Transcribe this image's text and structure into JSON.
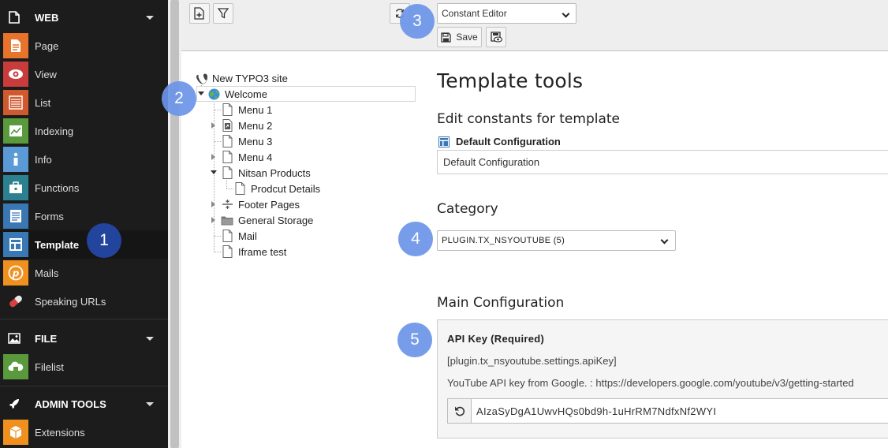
{
  "module_menu": {
    "groups": [
      {
        "title": "WEB",
        "icon": "web-icon",
        "items": [
          {
            "label": "Page",
            "icon": "page-icon",
            "color": "#e8732c"
          },
          {
            "label": "View",
            "icon": "view-icon",
            "color": "#c83c3c"
          },
          {
            "label": "List",
            "icon": "list-icon",
            "color": "#d05a2e"
          },
          {
            "label": "Indexing",
            "icon": "indexing-icon",
            "color": "#5a9a3c"
          },
          {
            "label": "Info",
            "icon": "info-icon",
            "color": "#5a9ad6"
          },
          {
            "label": "Functions",
            "icon": "functions-icon",
            "color": "#2c8090"
          },
          {
            "label": "Forms",
            "icon": "forms-icon",
            "color": "#3a78b4"
          },
          {
            "label": "Template",
            "icon": "template-icon",
            "color": "#3a78b4",
            "active": true
          },
          {
            "label": "Mails",
            "icon": "mails-icon",
            "color": "#f0901e"
          },
          {
            "label": "Speaking URLs",
            "icon": "speaking-urls-icon",
            "color": "#c83c3c"
          }
        ]
      },
      {
        "title": "FILE",
        "icon": "file-icon",
        "items": [
          {
            "label": "Filelist",
            "icon": "filelist-icon",
            "color": "#5a9a3c"
          }
        ]
      },
      {
        "title": "ADMIN TOOLS",
        "icon": "admin-tools-icon",
        "items": [
          {
            "label": "Extensions",
            "icon": "extensions-icon",
            "color": "#f0901e"
          }
        ]
      }
    ]
  },
  "docheader": {
    "function_select": {
      "selected": "Constant Editor"
    },
    "save_label": "Save"
  },
  "page_tree": {
    "root": "New TYPO3 site",
    "welcome": "Welcome",
    "children": [
      "Menu 1",
      "Menu 2",
      "Menu 3",
      "Menu 4",
      "Nitsan Products",
      "Prodcut Details",
      "Footer Pages",
      "General Storage",
      "Mail",
      "Iframe test"
    ]
  },
  "content": {
    "title": "Template tools",
    "edit_constants_heading": "Edit constants for template",
    "template_label": "Default Configuration",
    "template_value": "Default Configuration",
    "category_heading": "Category",
    "category_selected": "PLUGIN.TX_NSYOUTUBE (5)",
    "main_config_heading": "Main Configuration",
    "api_key": {
      "title": "API Key (Required)",
      "path": "[plugin.tx_nsyoutube.settings.apiKey]",
      "description": "YouTube API key from Google. : https://developers.google.com/youtube/v3/getting-started",
      "value": "AIzaSyDgA1UwvHQs0bd9h-1uHrRM7NdfxNf2WYI"
    }
  },
  "callouts": [
    "1",
    "2",
    "3",
    "4",
    "5"
  ]
}
